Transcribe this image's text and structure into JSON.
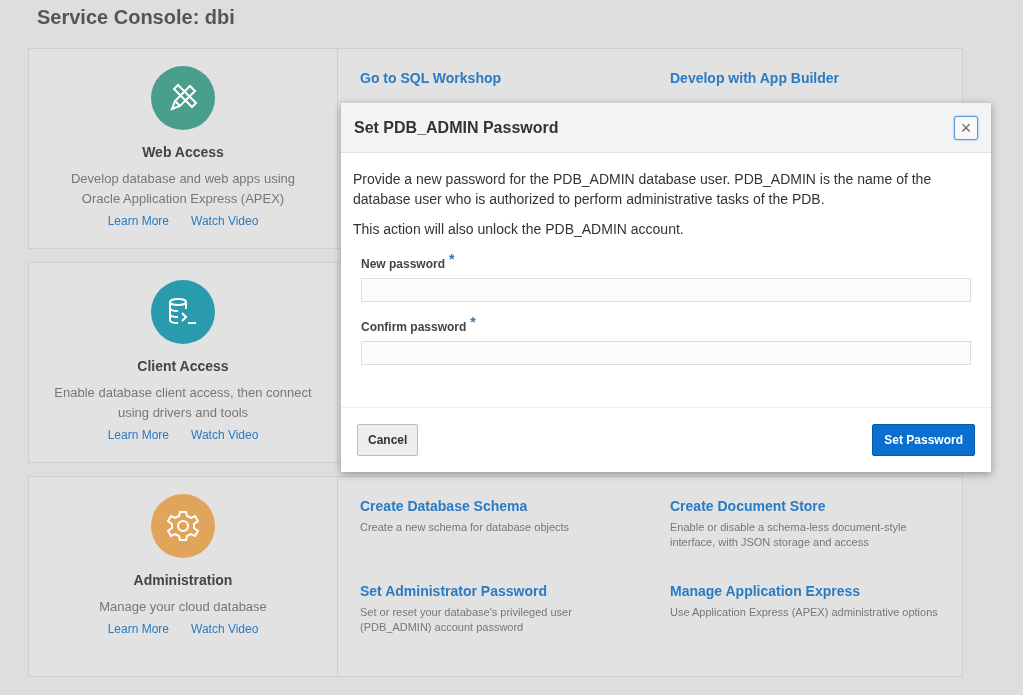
{
  "page_title": "Service Console: dbi",
  "sections": [
    {
      "kind": "pencil",
      "title": "Web Access",
      "description": "Develop database and web apps using Oracle Application Express (APEX)",
      "links": [
        "Learn More",
        "Watch Video"
      ],
      "actions": [
        {
          "title": "Go to SQL Workshop"
        },
        {
          "title": "Develop with App Builder"
        }
      ]
    },
    {
      "kind": "database",
      "title": "Client Access",
      "description": "Enable database client access, then connect using drivers and tools",
      "links": [
        "Learn More",
        "Watch Video"
      ]
    },
    {
      "kind": "gear",
      "title": "Administration",
      "description": "Manage your cloud database",
      "links": [
        "Learn More",
        "Watch Video"
      ],
      "actions": [
        {
          "title": "Create Database Schema",
          "description": "Create a new schema for database objects"
        },
        {
          "title": "Create Document Store",
          "description": "Enable or disable a schema-less document-style interface, with JSON storage and access"
        },
        {
          "title": "Set Administrator Password",
          "description": "Set or reset your database's privileged user (PDB_ADMIN) account password"
        },
        {
          "title": "Manage Application Express",
          "description": "Use Application Express (APEX) administrative options"
        }
      ]
    }
  ],
  "dialog": {
    "title": "Set PDB_ADMIN Password",
    "close": "×",
    "paragraphs": [
      "Provide a new password for the PDB_ADMIN database user. PDB_ADMIN is the name of the database user who is authorized to perform administrative tasks of the PDB.",
      "This action will also unlock the PDB_ADMIN account."
    ],
    "fields": [
      {
        "label": "New password",
        "required_mark": "*"
      },
      {
        "label": "Confirm password",
        "required_mark": "*"
      }
    ],
    "cancel": "Cancel",
    "submit": "Set Password"
  }
}
